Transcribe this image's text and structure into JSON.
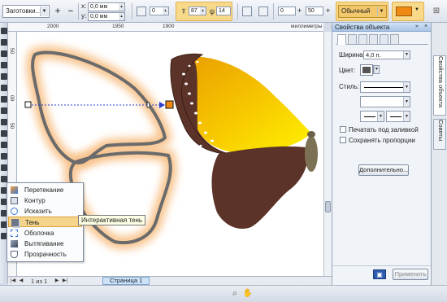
{
  "property_bar": {
    "preset_label": "Заготовки...",
    "x_value": "0,0 мм",
    "y_value": "0,0 мм",
    "transparency_value": "0",
    "opacity_value": "87",
    "feather_value": "14",
    "offset_value": "0",
    "stretch_value": "50",
    "blend_mode": "Обычный"
  },
  "ruler": {
    "labels": [
      "2000",
      "1950",
      "1900",
      "миллиметры"
    ],
    "v_labels": [
      "50",
      "00",
      "50"
    ]
  },
  "flyout": {
    "items": [
      {
        "label": "Перетекание",
        "icon": "blend-icon"
      },
      {
        "label": "Контур",
        "icon": "contour-icon"
      },
      {
        "label": "Исказить",
        "icon": "distort-icon"
      },
      {
        "label": "Тень",
        "icon": "shadow-icon"
      },
      {
        "label": "Оболочка",
        "icon": "envelope-icon"
      },
      {
        "label": "Вытягивание",
        "icon": "extrude-icon"
      },
      {
        "label": "Прозрачность",
        "icon": "transparency-icon"
      }
    ],
    "tooltip": "Интерактивная тень"
  },
  "page_nav": {
    "counter": "1 из 1",
    "page_tab": "Страница 1"
  },
  "docker": {
    "title": "Свойства объекта",
    "width_label": "Ширина:",
    "width_value": "4,0 п.",
    "color_label": "Цвет:",
    "style_label": "Стиль:",
    "behind_fill_label": "Печатать под заливкой",
    "keep_proportions_label": "Сохранять пропорции",
    "advanced_button": "Дополнительно...",
    "apply_button": "Применить"
  },
  "side_tabs": {
    "object_properties": "Свойства объекта",
    "hints": "Советы"
  },
  "colors": {
    "highlight": "#f6d48a",
    "wing_dark": "#5b3328",
    "wing_yellow": "#f2bf00",
    "outline_gray": "#6b6b6b",
    "shadow_glow": "#f6b068",
    "accent_orange": "#ee8a14"
  }
}
